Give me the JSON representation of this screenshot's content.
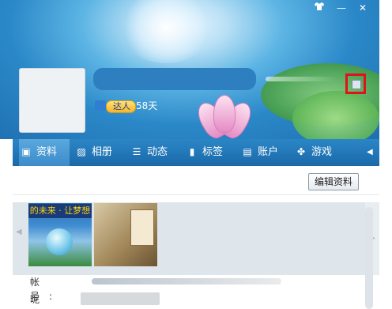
{
  "window": {
    "controls": {
      "skin": "shirt-icon",
      "minimize": "—",
      "close": "✕"
    }
  },
  "profile": {
    "level_badge": "达人",
    "days": "58天"
  },
  "tabs": [
    {
      "label": "资料",
      "icon": "profile-card-icon",
      "active": true
    },
    {
      "label": "相册",
      "icon": "photo-icon"
    },
    {
      "label": "动态",
      "icon": "list-icon"
    },
    {
      "label": "标签",
      "icon": "bookmark-icon"
    },
    {
      "label": "账户",
      "icon": "wallet-icon"
    },
    {
      "label": "游戏",
      "icon": "clover-icon"
    }
  ],
  "tab_arrows": "◀ ▶",
  "content": {
    "edit_button": "编辑资料",
    "photo1_caption": "的未来 · 让梦想",
    "fields": [
      {
        "label": "帐号:",
        "value": ""
      },
      {
        "label": "昵称:",
        "value": ""
      }
    ]
  },
  "colors": {
    "accent_border": "#e0121a",
    "tab_bar": "#1b69a9",
    "name_bar": "#2d7fc0"
  }
}
